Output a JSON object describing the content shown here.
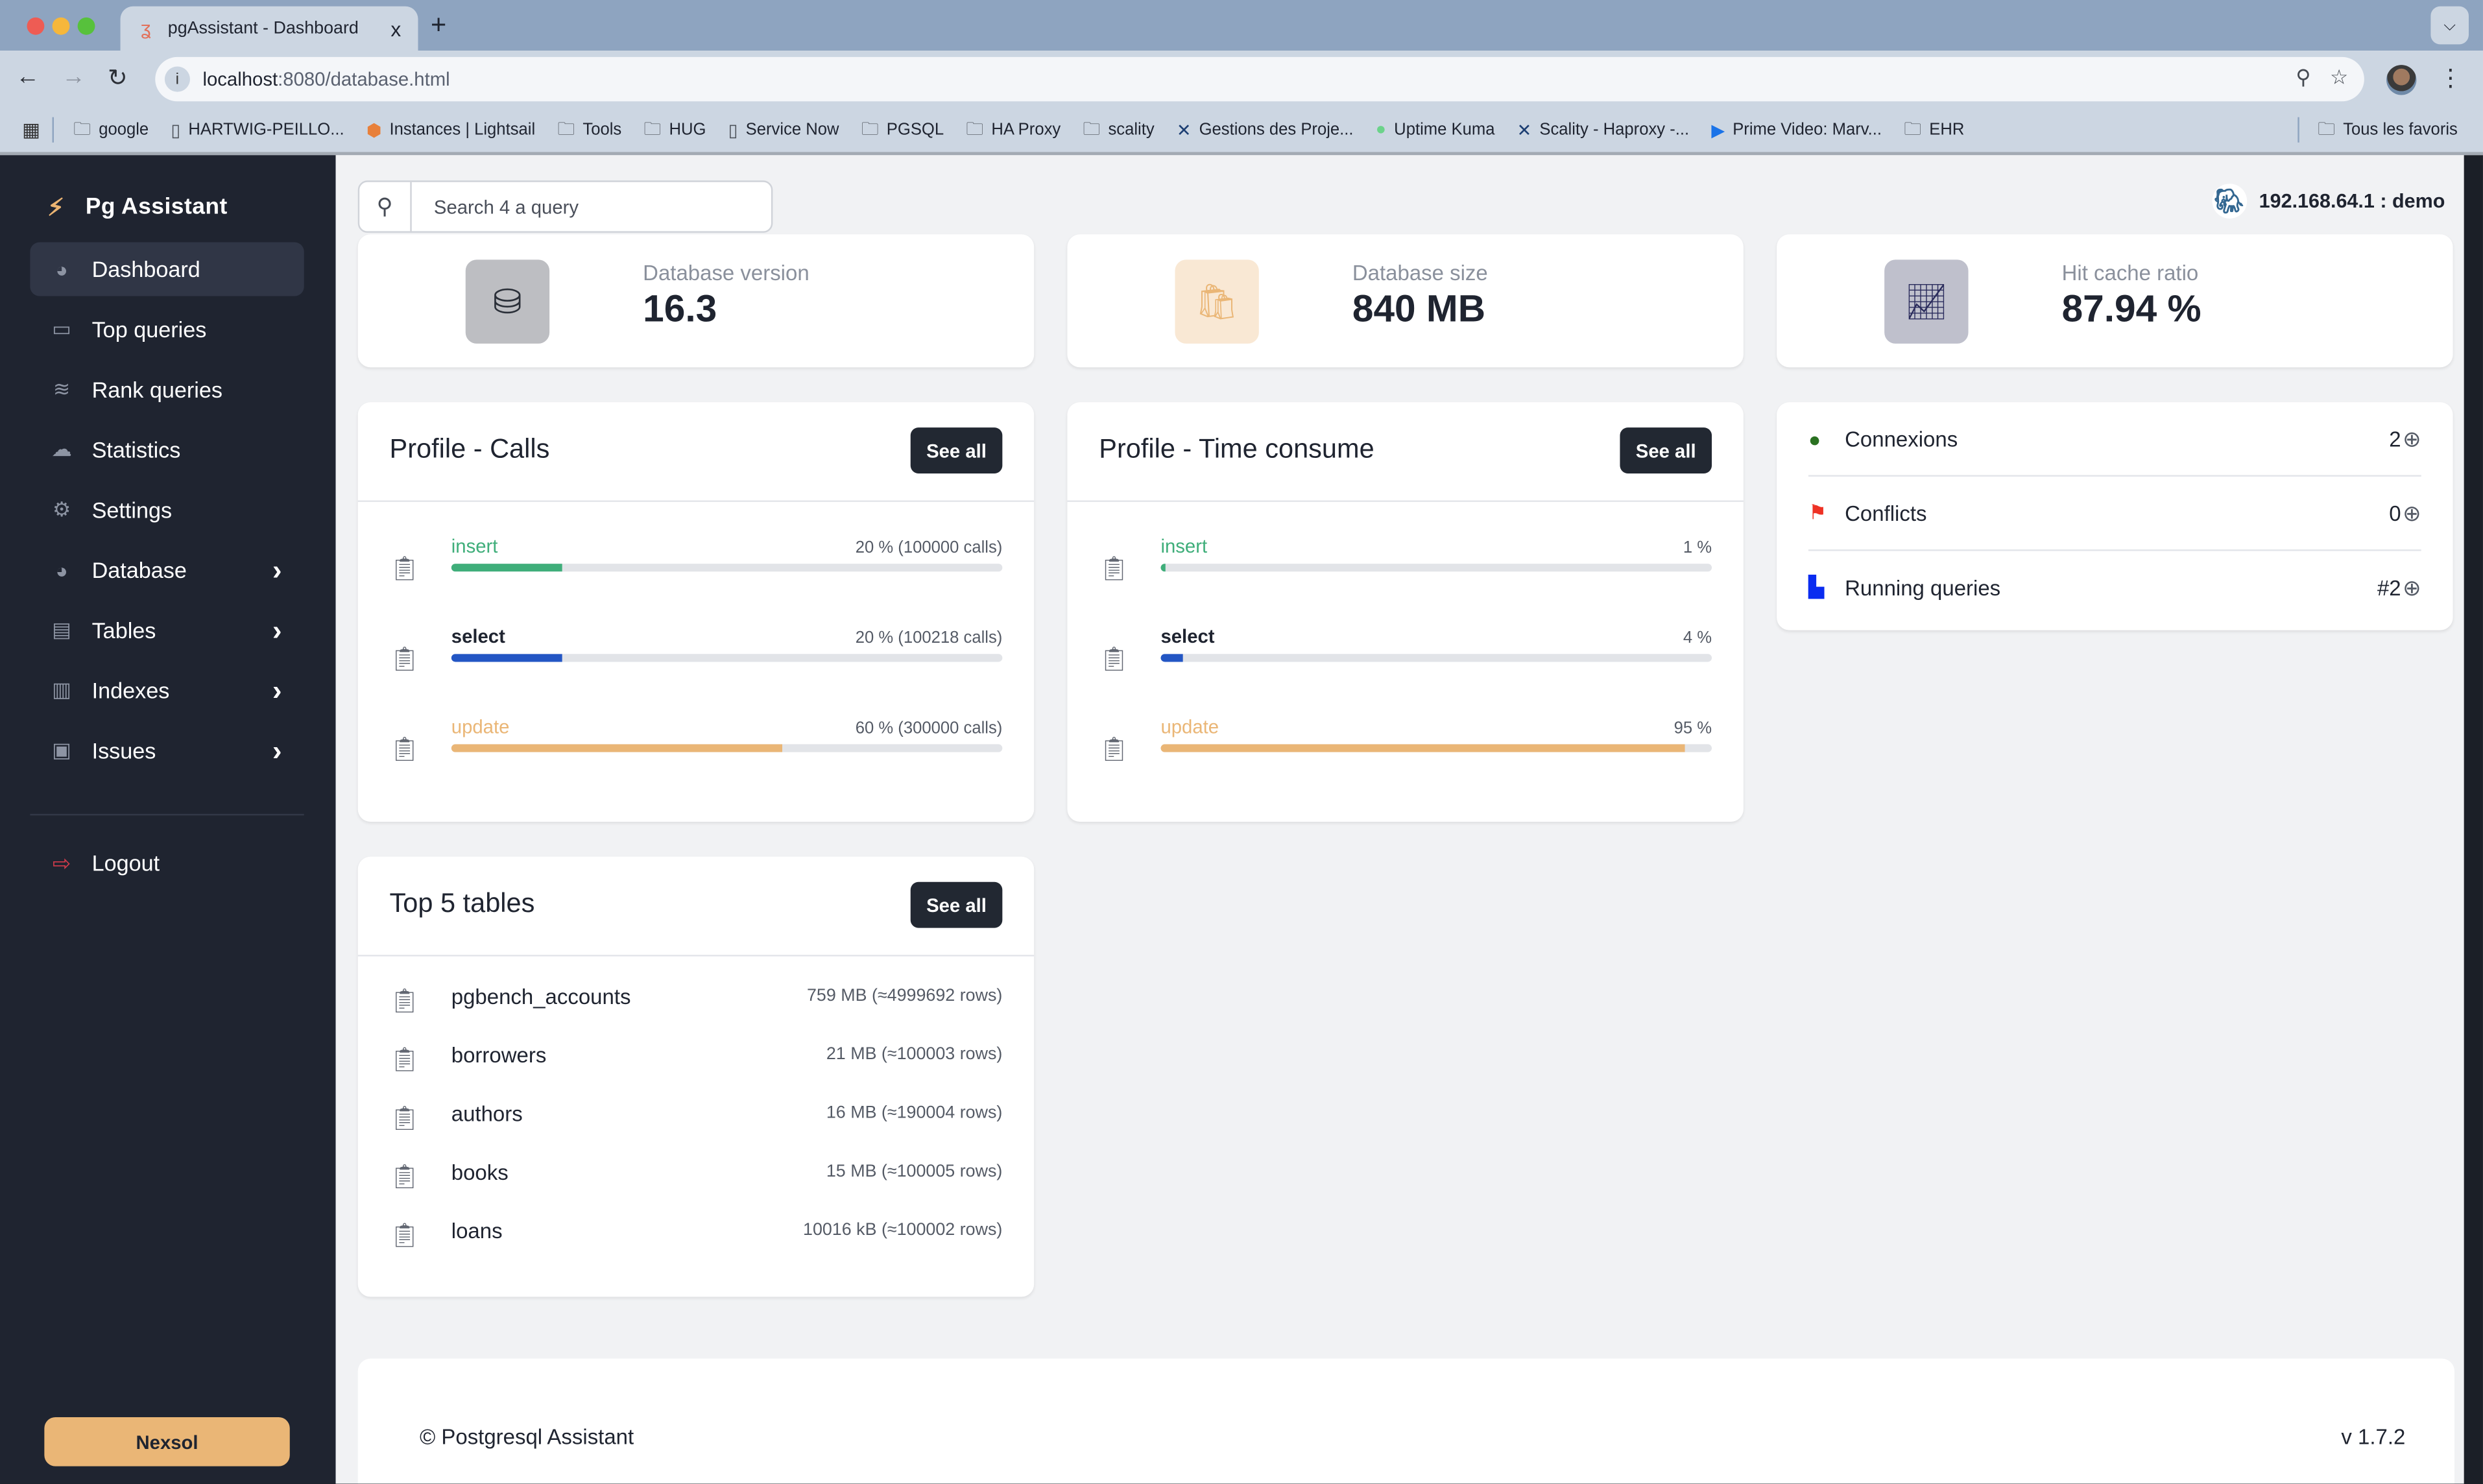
{
  "browser": {
    "tab_title": "pgAssistant - Dashboard",
    "tab_close": "x",
    "new_tab": "+",
    "url_host": "localhost",
    "url_path": ":8080/database.html",
    "bookmarks": [
      {
        "icon": "folder-icon",
        "label": "google"
      },
      {
        "icon": "page-icon",
        "label": "HARTWIG-PEILLO..."
      },
      {
        "icon": "lightsail-icon",
        "label": "Instances | Lightsail"
      },
      {
        "icon": "folder-icon",
        "label": "Tools"
      },
      {
        "icon": "folder-icon",
        "label": "HUG"
      },
      {
        "icon": "page-icon",
        "label": "Service Now"
      },
      {
        "icon": "folder-icon",
        "label": "PGSQL"
      },
      {
        "icon": "folder-icon",
        "label": "HA Proxy"
      },
      {
        "icon": "folder-icon",
        "label": "scality"
      },
      {
        "icon": "jira-icon",
        "label": "Gestions des Proje..."
      },
      {
        "icon": "uptime-icon",
        "label": "Uptime Kuma"
      },
      {
        "icon": "jira-icon",
        "label": "Scality - Haproxy -..."
      },
      {
        "icon": "play-icon",
        "label": "Prime Video: Marv..."
      },
      {
        "icon": "folder-icon",
        "label": "EHR"
      }
    ],
    "all_bookmarks": "Tous les favoris"
  },
  "sidebar": {
    "brand": "Pg Assistant",
    "items": [
      {
        "label": "Dashboard",
        "icon": "pie-chart-icon",
        "active": true,
        "has_children": false
      },
      {
        "label": "Top queries",
        "icon": "credit-card-icon",
        "active": false,
        "has_children": false
      },
      {
        "label": "Rank queries",
        "icon": "wifi-icon",
        "active": false,
        "has_children": false
      },
      {
        "label": "Statistics",
        "icon": "cloud-icon",
        "active": false,
        "has_children": false
      },
      {
        "label": "Settings",
        "icon": "gear-icon",
        "active": false,
        "has_children": false
      },
      {
        "label": "Database",
        "icon": "pie-chart-icon",
        "active": false,
        "has_children": true
      },
      {
        "label": "Tables",
        "icon": "table-icon",
        "active": false,
        "has_children": true
      },
      {
        "label": "Indexes",
        "icon": "index-icon",
        "active": false,
        "has_children": true
      },
      {
        "label": "Issues",
        "icon": "archive-icon",
        "active": false,
        "has_children": true
      }
    ],
    "logout": "Logout",
    "footer_button": "Nexsol"
  },
  "header": {
    "search_placeholder": "Search 4 a query",
    "search_value": "",
    "connection": "192.168.64.1 : demo"
  },
  "stats": [
    {
      "label": "Database version",
      "value": "16.3",
      "icon": "database-icon",
      "tile_color": "#bdbec2",
      "icon_color": "#2a2f38"
    },
    {
      "label": "Database size",
      "value": "840 MB",
      "icon": "shopping-bag-icon",
      "tile_color": "#f9e8d4",
      "icon_color": "#eab676"
    },
    {
      "label": "Hit cache ratio",
      "value": "87.94 %",
      "icon": "presentation-chart-icon",
      "tile_color": "#bfc0cc",
      "icon_color": "#2a2b5c"
    }
  ],
  "profile_calls": {
    "title": "Profile - Calls",
    "see_all": "See all",
    "rows": [
      {
        "name": "insert",
        "text": "20 % (100000 calls)",
        "percent": 20,
        "color": "#3fae7a"
      },
      {
        "name": "select",
        "text": "20 % (100218 calls)",
        "percent": 20,
        "color": "#2356c4"
      },
      {
        "name": "update",
        "text": "60 % (300000 calls)",
        "percent": 60,
        "color": "#eab676"
      }
    ]
  },
  "profile_time": {
    "title": "Profile - Time consume",
    "see_all": "See all",
    "rows": [
      {
        "name": "insert",
        "text": "1 %",
        "percent": 1,
        "color": "#3fae7a"
      },
      {
        "name": "select",
        "text": "4 %",
        "percent": 4,
        "color": "#2356c4"
      },
      {
        "name": "update",
        "text": "95 %",
        "percent": 95,
        "color": "#eab676"
      }
    ]
  },
  "metrics": [
    {
      "label": "Connexions",
      "value": "2",
      "icon": "green-dot-icon",
      "color": "#2a7121"
    },
    {
      "label": "Conflicts",
      "value": "0",
      "icon": "flag-icon",
      "color": "#ee3124"
    },
    {
      "label": "Running queries",
      "value": "#2",
      "icon": "folder-open-icon",
      "color": "#0a2cf0"
    }
  ],
  "top_tables": {
    "title": "Top 5 tables",
    "see_all": "See all",
    "rows": [
      {
        "name": "pgbench_accounts",
        "size": "759 MB (≈4999692 rows)"
      },
      {
        "name": "borrowers",
        "size": "21 MB (≈100003 rows)"
      },
      {
        "name": "authors",
        "size": "16 MB (≈190004 rows)"
      },
      {
        "name": "books",
        "size": "15 MB (≈100005 rows)"
      },
      {
        "name": "loans",
        "size": "10016 kB (≈100002 rows)"
      }
    ]
  },
  "footer": {
    "copyright": "© Postgresql Assistant",
    "version": "v 1.7.2"
  }
}
